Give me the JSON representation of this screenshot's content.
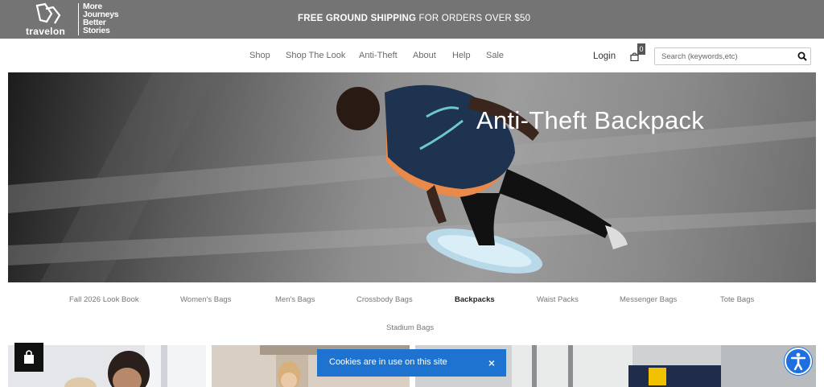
{
  "brand": {
    "wordmark": "travelon",
    "tagline": "More\nJourneys\nBetter\nStories"
  },
  "promo": {
    "bold": "FREE GROUND SHIPPING",
    "rest": " FOR ORDERS OVER $50"
  },
  "nav": {
    "items": [
      "Shop",
      "Shop The Look",
      "Anti-Theft",
      "About",
      "Help",
      "Sale"
    ]
  },
  "account": {
    "login": "Login",
    "cart_count": "0"
  },
  "search": {
    "placeholder": "Search (keywords,etc)"
  },
  "hero": {
    "title": "Anti-Theft Backpack"
  },
  "categories": {
    "items": [
      "Fall 2026 Look Book",
      "Women's Bags",
      "Men's Bags",
      "Crossbody Bags",
      "Backpacks",
      "Waist Packs",
      "Messenger Bags",
      "Tote Bags",
      "Stadium Bags"
    ],
    "active": "Backpacks"
  },
  "cookie": {
    "text": "Cookies are in use on this site",
    "close": "×"
  },
  "icons": [
    "logo-mark-icon",
    "shopping-bag-icon",
    "search-icon",
    "accessibility-icon"
  ],
  "colors": {
    "topbar": "#747474",
    "cookie": "#1e73d0",
    "a11y": "#1e6fe0"
  }
}
